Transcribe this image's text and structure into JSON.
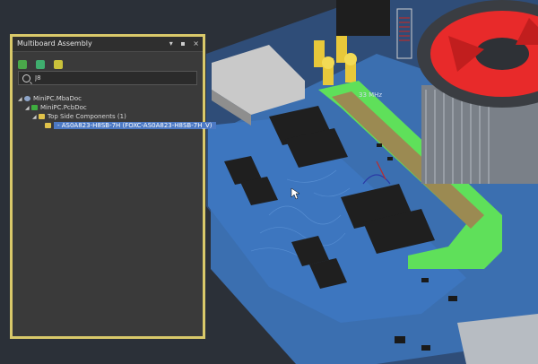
{
  "panel": {
    "title": "Multiboard Assembly",
    "controls": {
      "menu": "▾",
      "pin": "▪",
      "close": "×"
    },
    "search": {
      "value": "J8"
    },
    "tree": [
      {
        "label": "MiniPC.MbaDoc",
        "level": 0,
        "icon": "assembly-icon"
      },
      {
        "label": "MiniPC.PcbDoc",
        "level": 1,
        "icon": "pcb-doc-icon"
      },
      {
        "label": "Top Side Components (1)",
        "level": 2,
        "icon": "folder-icon"
      },
      {
        "label": "- AS0A823-H8SB-7H (FOXC-AS0A823-H8SB-7H_V)",
        "level": 3,
        "icon": "component-icon",
        "selected": true
      }
    ]
  },
  "viewport": {
    "label": "33 MHz"
  },
  "colors": {
    "panel_border": "#d9c96a",
    "selection": "#4c79c4",
    "pcb_blue": "#3b6fb0",
    "connector_green": "#5fe05a",
    "fan_red": "#e82a2a"
  }
}
